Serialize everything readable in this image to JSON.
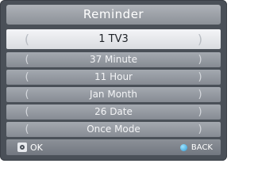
{
  "title": "Reminder",
  "rows": [
    {
      "label": "1 TV3"
    },
    {
      "label": "37 Minute"
    },
    {
      "label": "11 Hour"
    },
    {
      "label": "Jan Month"
    },
    {
      "label": "26 Date"
    },
    {
      "label": "Once Mode"
    }
  ],
  "arrows": {
    "left": "(",
    "right": ")"
  },
  "footer": {
    "ok_label": "OK",
    "back_label": "BACK"
  },
  "colors": {
    "accent_blue": "#2e9ad6",
    "panel": "#4a5058"
  },
  "icons": {
    "ok": "ok-button-icon",
    "back": "blue-dot-icon"
  }
}
